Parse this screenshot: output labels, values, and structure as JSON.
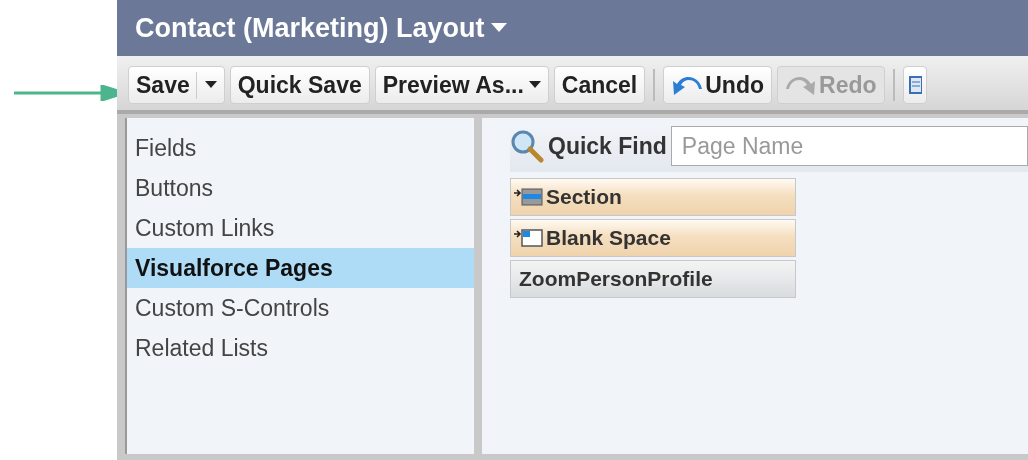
{
  "title": "Contact (Marketing) Layout",
  "toolbar": [
    {
      "kind": "split",
      "label": "Save",
      "disabled": false
    },
    {
      "kind": "plain",
      "label": "Quick Save",
      "disabled": false
    },
    {
      "kind": "menu",
      "label": "Preview As...",
      "disabled": false
    },
    {
      "kind": "plain",
      "label": "Cancel",
      "disabled": false
    },
    {
      "kind": "separator"
    },
    {
      "kind": "undo",
      "label": "Undo",
      "disabled": false
    },
    {
      "kind": "redo",
      "label": "Redo",
      "disabled": true
    },
    {
      "kind": "separator"
    },
    {
      "kind": "icon",
      "disabled": false
    }
  ],
  "sidebar": {
    "items": [
      {
        "label": "Fields",
        "selected": false
      },
      {
        "label": "Buttons",
        "selected": false
      },
      {
        "label": "Custom Links",
        "selected": false
      },
      {
        "label": "Visualforce Pages",
        "selected": true
      },
      {
        "label": "Custom S-Controls",
        "selected": false
      },
      {
        "label": "Related Lists",
        "selected": false
      }
    ]
  },
  "quick_find": {
    "label": "Quick Find",
    "placeholder": "Page Name"
  },
  "palette": [
    {
      "kind": "section",
      "label": "Section"
    },
    {
      "kind": "blank",
      "label": "Blank Space"
    },
    {
      "kind": "page",
      "label": "ZoomPersonProfile"
    }
  ]
}
